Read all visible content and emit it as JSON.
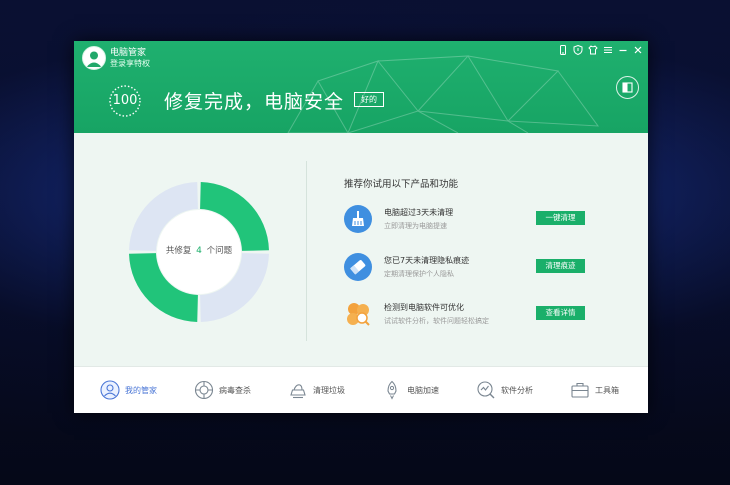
{
  "app": {
    "title": "电脑管家",
    "subtitle": "登录享特权"
  },
  "header": {
    "score": "100",
    "status_title": "修复完成，电脑安全",
    "status_badge": "好的"
  },
  "summary": {
    "prefix": "共修复",
    "count": "4",
    "suffix": "个问题"
  },
  "recommend": {
    "title": "推荐你试用以下产品和功能",
    "items": [
      {
        "title": "电脑超过3天未清理",
        "desc": "立即清理为电脑提速",
        "button": "一键清理",
        "icon": "broom-icon",
        "color": "#3f8fe0"
      },
      {
        "title": "您已7天未清理隐私痕迹",
        "desc": "定期清理保护个人隐私",
        "button": "清理痕迹",
        "icon": "eraser-icon",
        "color": "#3f8fe0"
      },
      {
        "title": "检测到电脑软件可优化",
        "desc": "试试软件分析，软件问题轻松搞定",
        "button": "查看详情",
        "icon": "software-analysis-icon",
        "color": "#f3a23d"
      }
    ]
  },
  "nav": [
    {
      "label": "我的管家",
      "icon": "butler-icon",
      "active": true
    },
    {
      "label": "病毒查杀",
      "icon": "virus-scan-icon",
      "active": false
    },
    {
      "label": "清理垃圾",
      "icon": "cleanup-icon",
      "active": false
    },
    {
      "label": "电脑加速",
      "icon": "rocket-icon",
      "active": false
    },
    {
      "label": "软件分析",
      "icon": "software-analysis-icon",
      "active": false
    },
    {
      "label": "工具箱",
      "icon": "toolbox-icon",
      "active": false
    }
  ],
  "colors": {
    "brand": "#1aaf6a",
    "header_bg": "#17a464",
    "body_bg": "#eef6f2"
  }
}
